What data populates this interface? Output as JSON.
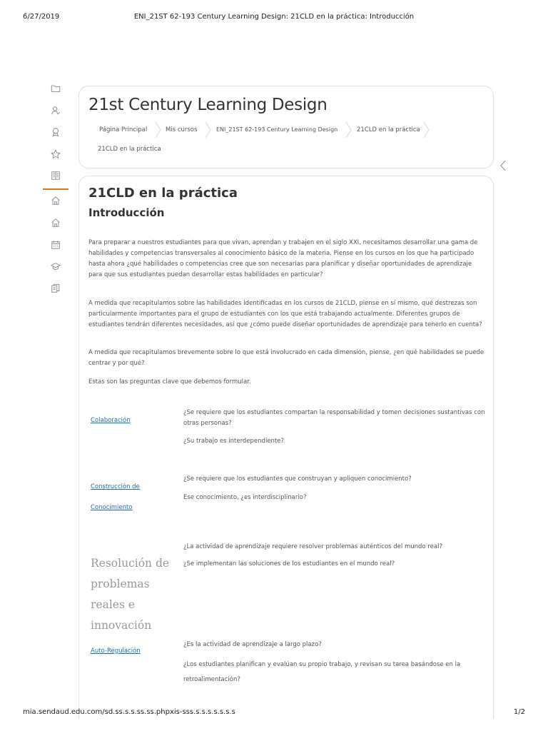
{
  "print_header": {
    "date": "6/27/2019",
    "title": "ENI_21ST 62-193 Century Learning Design: 21CLD en la práctica: Introducción"
  },
  "print_footer": {
    "url": "mia.sendaud.edu.com/sd.ss.s.s.ss.ss.phpxis-sss.s.s.s.s.s.s.s",
    "page": "1/2"
  },
  "sidebar": {
    "items": [
      {
        "icon": "folder-icon"
      },
      {
        "icon": "user-badge-icon"
      },
      {
        "icon": "award-icon"
      },
      {
        "icon": "star-icon"
      },
      {
        "icon": "book-icon"
      },
      {
        "icon": "home-icon",
        "active": true
      },
      {
        "icon": "home-icon"
      },
      {
        "icon": "calendar-icon"
      },
      {
        "icon": "graduation-cap-icon"
      },
      {
        "icon": "copy-document-icon"
      }
    ]
  },
  "header": {
    "course_title": "21st Century Learning Design",
    "breadcrumb": [
      "Página Principal",
      "Mis cursos",
      "ENI_21ST 62-193 Century Learning Design",
      "21CLD en la práctica",
      "21CLD en la práctica"
    ]
  },
  "content": {
    "title": "21CLD en la práctica",
    "subtitle": "Introducción",
    "paragraphs": [
      "Para preparar a nuestros estudiantes para que vivan, aprendan y trabajen en el siglo XXI, necesitamos desarrollar una gama de habilidades y competencias transversales al conocimiento básico de la materia. Piense en los cursos en los que ha participado hasta ahora ¿qué habilidades o competencias cree que son necesarias para planificar y diseñar oportunidades de aprendizaje para que sus estudiantes puedan desarrollar estas habilidades en particular?",
      "A medida que recapitulamos sobre las habilidades identificadas en los cursos de 21CLD, piense en sí mismo, qué destrezas son particularmente importantes para el grupo de estudiantes con los que está trabajando actualmente. Diferentes grupos de estudiantes tendrán diferentes necesidades, así que ¿cómo puede diseñar oportunidades de aprendizaje para tenerlo en cuenta?",
      "A medida que recapitulamos brevemente sobre lo que está involucrado en cada dimensión, piense, ¿en qué habilidades se puede centrar y por qué?",
      "Estas son las preguntas clave que debemos formular."
    ],
    "dimensions": [
      {
        "label": "Colaboración",
        "questions": [
          "¿Se requiere que los estudiantes compartan la responsabilidad y tomen decisiones sustantivas con otras personas?",
          "¿Su trabajo es interdependiente?"
        ]
      },
      {
        "label_line1": "Construcción de",
        "label_line2": "Conocimiento",
        "questions": [
          "¿Se requiere que los estudiantes que construyan y apliquen conocimiento?",
          "Ese conocimiento, ¿es interdisciplinario?"
        ]
      },
      {
        "label": "Resolución de problemas reales e innovación",
        "questions": [
          "¿La actividad de aprendizaje requiere resolver problemas auténticos del mundo real?",
          "¿Se implementan las soluciones de los estudiantes en el mundo real?"
        ]
      },
      {
        "label": "Auto-Regulación",
        "questions": [
          "¿Es la actividad de aprendizaje a largo plazo?",
          "¿Los estudiantes planifican y evalúan su propio trabajo, y revisan su tarea basándose en la retroalimentación?"
        ]
      }
    ]
  },
  "colors": {
    "accent": "#ef6c27",
    "link": "#1a6fc0",
    "border": "#e2e2e2"
  }
}
